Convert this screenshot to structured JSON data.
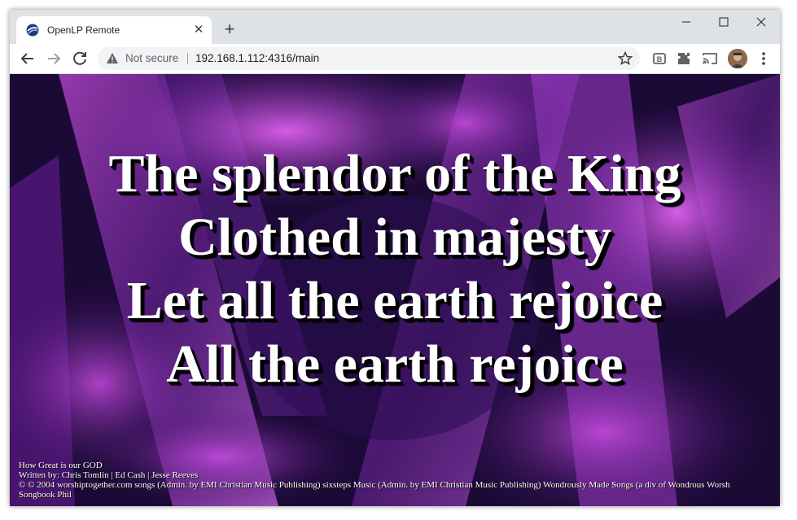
{
  "browser": {
    "tab": {
      "title": "OpenLP Remote"
    },
    "new_tab_symbol": "+",
    "tab_close_symbol": "✕",
    "address_bar": {
      "security_label": "Not secure",
      "url": "192.168.1.112:4316/main"
    },
    "icons": [
      "back-icon",
      "forward-icon",
      "reload-icon",
      "info-icon",
      "star-icon",
      "reader-mode-icon",
      "extensions-icon",
      "cast-icon",
      "avatar",
      "menu-icon",
      "minimize-icon",
      "maximize-icon",
      "close-icon"
    ]
  },
  "slide": {
    "lines": [
      "The splendor of the King",
      "Clothed in majesty",
      "Let all the earth rejoice",
      "All the earth rejoice"
    ],
    "footer": [
      "How Great is our GOD",
      "Written by: Chris Tomlin | Ed Cash | Jesse Reeves",
      "© © 2004 worshiptogether.com songs (Admin. by EMI Christian Music Publishing) sixsteps Music (Admin. by EMI Christian Music Publishing) Wondrously Made Songs (a div of Wondrous Worsh",
      "Songbook Phil"
    ]
  },
  "colors": {
    "tab_strip": "#dee1e6",
    "slide_background": "#1c0a36",
    "slide_accent": "#c040e0",
    "lyric_text": "#ffffff"
  }
}
